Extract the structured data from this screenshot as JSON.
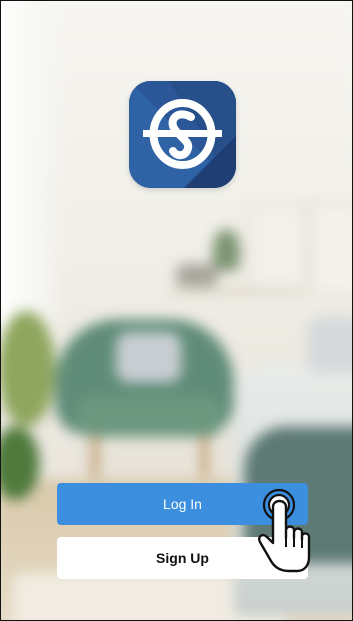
{
  "app": {
    "logo_icon": "app-logo-icon",
    "logo_colors": {
      "light": "#2f63a6",
      "dark": "#1f3f74",
      "mark": "#ffffff"
    }
  },
  "buttons": {
    "login_label": "Log In",
    "signup_label": "Sign Up"
  },
  "gesture": {
    "icon": "tap-hand-icon"
  },
  "colors": {
    "primary": "#3c8fde",
    "secondary_bg": "#ffffff"
  }
}
